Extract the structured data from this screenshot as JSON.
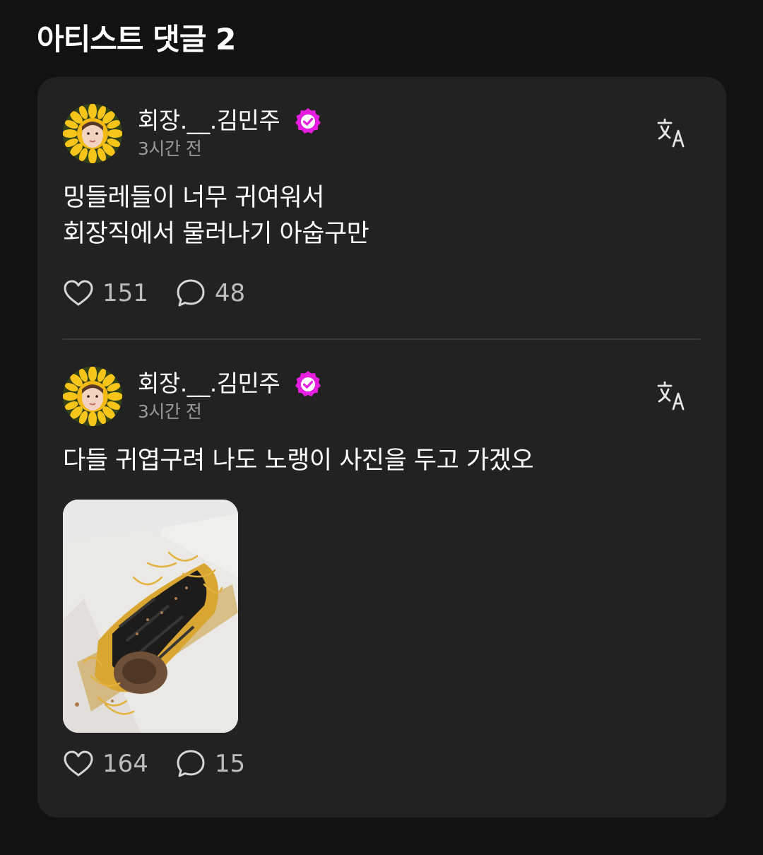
{
  "page": {
    "title": "아티스트 댓글 2"
  },
  "comments": [
    {
      "author": "회장.__.김민주",
      "time": "3시간 전",
      "lines": [
        "밍들레들이 너무 귀여워서",
        "회장직에서 물러나기 아숩구만"
      ],
      "likes": "151",
      "replies": "48"
    },
    {
      "author": "회장.__.김민주",
      "time": "3시간 전",
      "lines": [
        "다들 귀엽구려 나도 노랭이 사진을 두고 가겠오"
      ],
      "likes": "164",
      "replies": "15"
    }
  ],
  "icons": {
    "verified": "verified-badge-icon",
    "translate": "translate-icon",
    "like": "heart-icon",
    "reply": "speech-bubble-icon"
  },
  "colors": {
    "background": "#121212",
    "card": "#222222",
    "verified_badge": "#e51ee0",
    "secondary_text": "#9a9a9a"
  }
}
